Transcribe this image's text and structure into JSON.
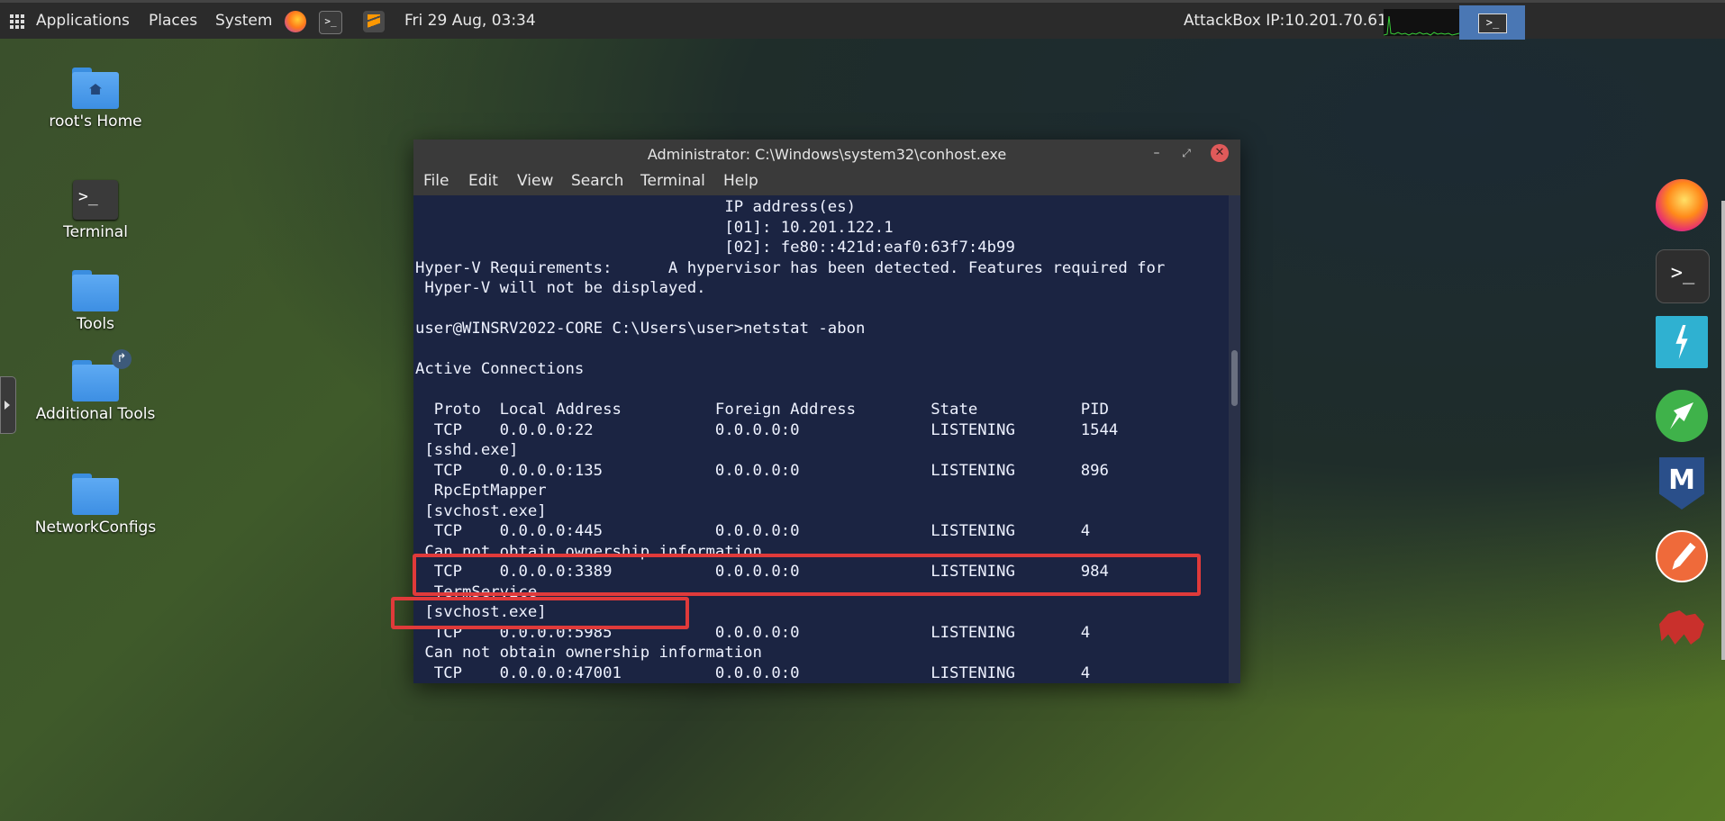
{
  "top_panel": {
    "applications": "Applications",
    "places": "Places",
    "system": "System",
    "datetime": "Fri 29 Aug, 03:34",
    "attackbox_ip": "AttackBox IP:10.201.70.61",
    "icons": [
      "apps-grid-icon",
      "firefox-icon",
      "terminal-icon",
      "sublime-text-icon",
      "system-monitor-graph",
      "terminal-task-icon"
    ]
  },
  "desktop": {
    "icons": [
      {
        "label": "root's Home",
        "icon": "home-folder-icon"
      },
      {
        "label": "Terminal",
        "icon": "terminal-icon"
      },
      {
        "label": "Tools",
        "icon": "folder-icon"
      },
      {
        "label": "Additional Tools",
        "icon": "shared-folder-icon"
      },
      {
        "label": "NetworkConfigs",
        "icon": "folder-icon"
      }
    ]
  },
  "dock": [
    "firefox-icon",
    "terminal-icon",
    "zap-icon",
    "rocket-icon",
    "metasploit-icon",
    "postman-icon",
    "panther-icon"
  ],
  "window": {
    "title": "Administrator: C:\\Windows\\system32\\conhost.exe",
    "menu": [
      "File",
      "Edit",
      "View",
      "Search",
      "Terminal",
      "Help"
    ],
    "lines": [
      "                                 IP address(es)",
      "                                 [01]: 10.201.122.1",
      "                                 [02]: fe80::421d:eaf0:63f7:4b99",
      "Hyper-V Requirements:      A hypervisor has been detected. Features required for",
      " Hyper-V will not be displayed.",
      "",
      "user@WINSRV2022-CORE C:\\Users\\user>netstat -abon",
      "",
      "Active Connections",
      "",
      "  Proto  Local Address          Foreign Address        State           PID",
      "  TCP    0.0.0.0:22             0.0.0.0:0              LISTENING       1544",
      " [sshd.exe]",
      "  TCP    0.0.0.0:135            0.0.0.0:0              LISTENING       896",
      "  RpcEptMapper",
      " [svchost.exe]",
      "  TCP    0.0.0.0:445            0.0.0.0:0              LISTENING       4",
      " Can not obtain ownership information",
      "  TCP    0.0.0.0:3389           0.0.0.0:0              LISTENING       984",
      "  TermService",
      " [svchost.exe]",
      "  TCP    0.0.0.0:5985           0.0.0.0:0              LISTENING       4",
      " Can not obtain ownership information",
      "  TCP    0.0.0.0:47001          0.0.0.0:0              LISTENING       4"
    ]
  },
  "colors": {
    "panel": "#2b2b2b",
    "terminal_bg": "#1b2442",
    "highlight": "#e03a3a",
    "active_task": "#4a77b4"
  }
}
